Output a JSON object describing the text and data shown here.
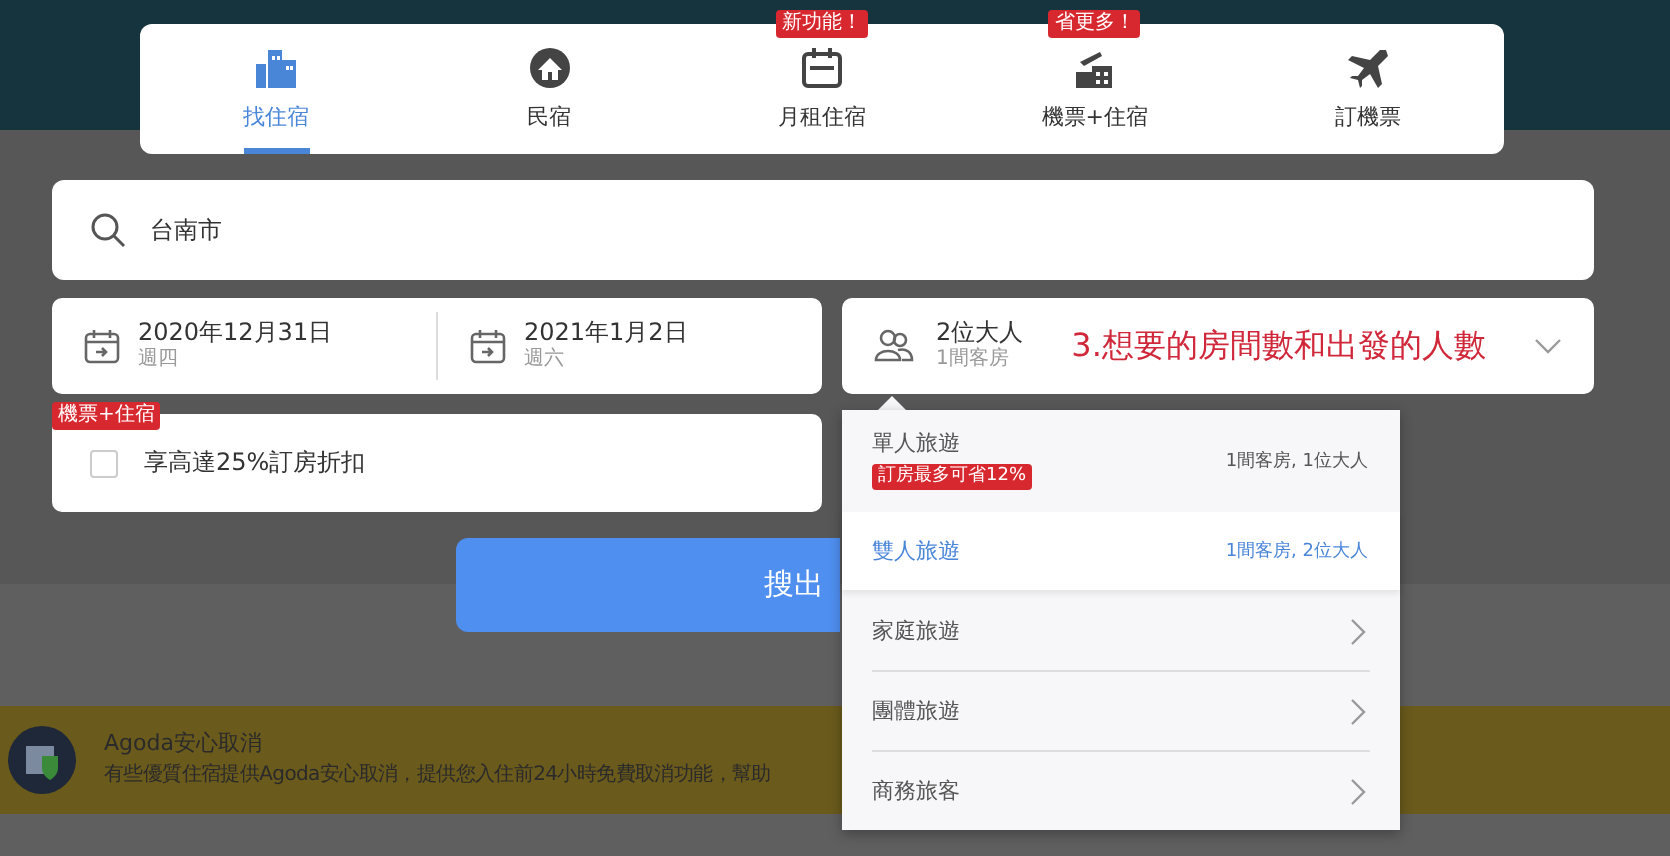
{
  "tabs": [
    {
      "label": "找住宿",
      "selected": true
    },
    {
      "label": "民宿",
      "selected": false
    },
    {
      "label": "月租住宿",
      "selected": false,
      "badge": "新功能！"
    },
    {
      "label": "機票+住宿",
      "selected": false,
      "badge": "省更多！"
    },
    {
      "label": "訂機票",
      "selected": false
    }
  ],
  "search": {
    "value": "台南市"
  },
  "dates": [
    {
      "date": "2020年12月31日",
      "weekday": "週四"
    },
    {
      "date": "2021年1月2日",
      "weekday": "週六"
    }
  ],
  "guests": {
    "adults": "2位大人",
    "rooms": "1間客房",
    "expanded": true
  },
  "annotation": "3.想要的房間數和出發的人數",
  "package_deal": {
    "badge": "機票+住宿",
    "label": "享高達25%訂房折扣",
    "checked": false
  },
  "search_button": "搜出",
  "guest_options": [
    {
      "kind": "preset",
      "label": "單人旅遊",
      "detail": "1間客房, 1位大人",
      "badge": "訂房最多可省12%",
      "selected": false
    },
    {
      "kind": "preset",
      "label": "雙人旅遊",
      "detail": "1間客房, 2位大人",
      "selected": true
    },
    {
      "kind": "submenu",
      "label": "家庭旅遊",
      "selected": false
    },
    {
      "kind": "submenu",
      "label": "團體旅遊",
      "selected": false
    },
    {
      "kind": "submenu",
      "label": "商務旅客",
      "selected": false
    }
  ],
  "banner": {
    "title": "Agoda安心取消",
    "text": "有些優質住宿提供Agoda安心取消，提供您入住前24小時免費取消功能，幫助"
  }
}
